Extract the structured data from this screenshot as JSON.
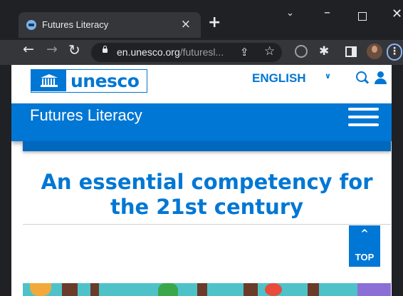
{
  "browser": {
    "tab": {
      "title": "Futures Literacy",
      "close": "×",
      "new_tab": "+"
    },
    "window_controls": {
      "tab_search": "⌄",
      "minimize": "–",
      "close": "✕"
    },
    "nav": {
      "back": "←",
      "forward": "→",
      "reload": "↻",
      "menu": "⋮"
    },
    "omnibox": {
      "domain": "en.unesco.org",
      "path": "/futuresl..."
    },
    "icons": {
      "share": "⇪",
      "star": "☆",
      "extensions": "✱"
    }
  },
  "site": {
    "logo_text": "unesco",
    "language": "ENGLISH",
    "section_title": "Futures Literacy",
    "headline": "An essential competency for the 21st century",
    "top_button": {
      "icon": "^",
      "label": "TOP"
    }
  },
  "colors": {
    "brand_blue": "#0077d4",
    "chrome_dark": "#202124",
    "chrome_mid": "#35363a"
  }
}
